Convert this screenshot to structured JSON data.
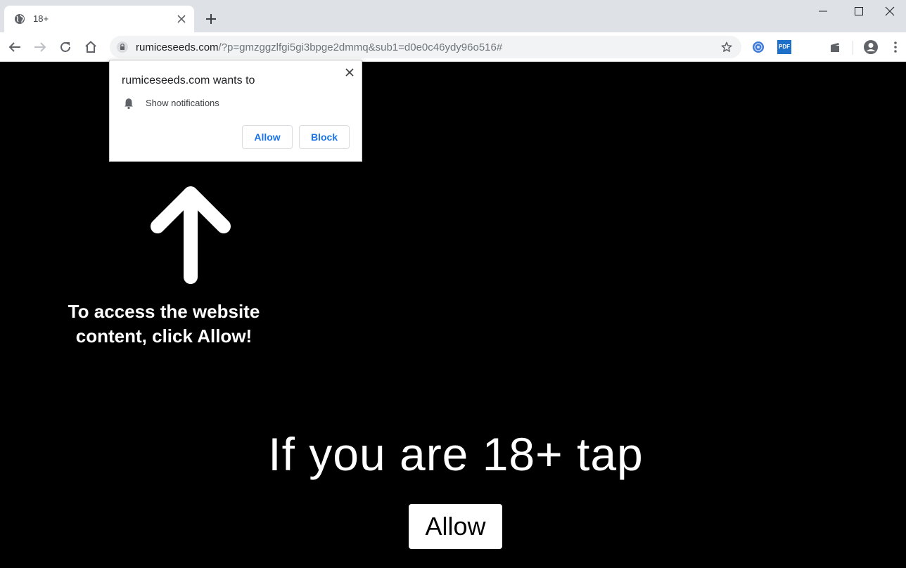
{
  "tab": {
    "title": "18+",
    "favicon": "globe-icon"
  },
  "toolbar": {
    "url_host": "rumiceseeds.com",
    "url_path": "/?p=gmzggzlfgi5gi3bpge2dmmq&sub1=d0e0c46ydy96o516#",
    "ext_pdf_label": "PDF"
  },
  "permission": {
    "title": "rumiceseeds.com wants to",
    "item": "Show notifications",
    "allow": "Allow",
    "block": "Block"
  },
  "page": {
    "hint_line1": "To access the website",
    "hint_line2": "content, click Allow!",
    "headline": "If you are 18+ tap",
    "button": "Allow"
  },
  "colors": {
    "accent": "#1a73e8",
    "page_bg": "#000000",
    "tabstrip_bg": "#dee1e6"
  }
}
